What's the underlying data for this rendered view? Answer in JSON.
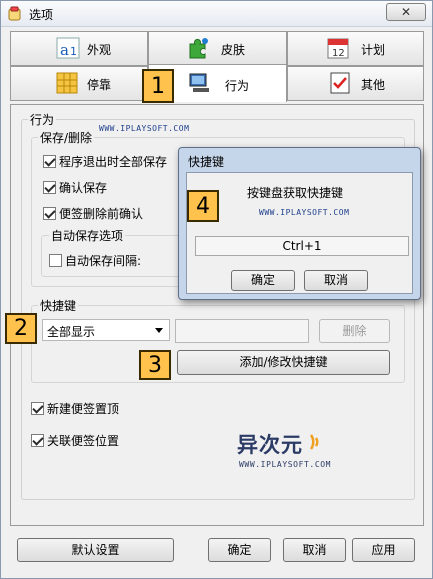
{
  "window": {
    "title": "选项",
    "close_symbol": "✕"
  },
  "tabs_row1": [
    {
      "label": "外观",
      "icon": "font-icon"
    },
    {
      "label": "皮肤",
      "icon": "puzzle-icon"
    },
    {
      "label": "计划",
      "icon": "calendar-icon"
    }
  ],
  "tabs_row2": [
    {
      "label": "停靠",
      "icon": "dock-grid-icon"
    },
    {
      "label": "行为",
      "icon": "computer-icon",
      "active": true
    },
    {
      "label": "其他",
      "icon": "checklist-icon"
    }
  ],
  "behavior": {
    "title": "行为",
    "save_delete_title": "保存/删除",
    "checkboxes": [
      {
        "label": "程序退出时全部保存",
        "checked": true
      },
      {
        "label": "确认保存",
        "checked": true
      },
      {
        "label": "便签删除前确认",
        "checked": true
      }
    ],
    "autosave_title": "自动保存选项",
    "autosave_interval_label": "自动保存间隔:",
    "autosave_checked": false
  },
  "hotkey": {
    "title": "快捷键",
    "select_value": "全部显示",
    "delete_label": "删除",
    "add_modify_label": "添加/修改快捷键"
  },
  "extra_checkboxes": [
    {
      "label": "新建便签置顶",
      "checked": true
    },
    {
      "label": "关联便签位置",
      "checked": true
    }
  ],
  "footer": {
    "default_label": "默认设置",
    "ok_label": "确定",
    "cancel_label": "取消",
    "apply_label": "应用"
  },
  "dialog": {
    "title": "快捷键",
    "prompt": "按键盘获取快捷键",
    "key_value": "Ctrl+1",
    "ok_label": "确定",
    "cancel_label": "取消"
  },
  "watermark": "WWW.IPLAYSOFT.COM",
  "brand": {
    "name": "异次元",
    "site": "WWW.IPLAYSOFT.COM"
  },
  "callouts": [
    "1",
    "2",
    "3",
    "4"
  ],
  "colors": {
    "callout_fill": "#ffc34d",
    "dialog_frame": "#c6d6ea",
    "brand_text": "#2b3b66"
  }
}
